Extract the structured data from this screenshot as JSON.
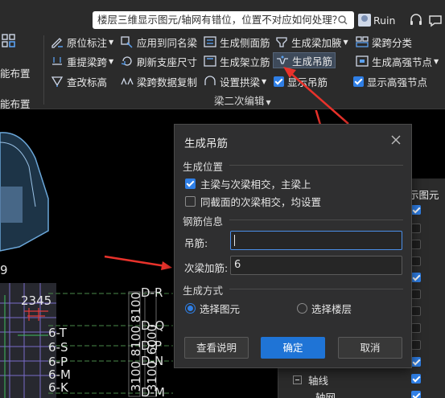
{
  "titlebar": {
    "search_text": "楼层三维显示图元/轴网有错位，位置不对应如何处理？",
    "username": "Ruin"
  },
  "ribbon": {
    "left_fragments": [
      "能布置",
      "能布置"
    ],
    "row1": [
      {
        "label": "原位标注",
        "icon": "annotation-icon",
        "caret": true
      },
      {
        "label": "应用到同名梁",
        "icon": "apply-same-name-icon"
      },
      {
        "label": "生成侧面筋",
        "icon": "side-rebar-icon"
      },
      {
        "label": "生成梁加腋",
        "icon": "haunch-icon",
        "caret": true
      },
      {
        "label": "梁跨分类",
        "icon": "span-classify-icon"
      }
    ],
    "row2": [
      {
        "label": "重提梁跨",
        "icon": "re-extract-span-icon",
        "caret": true
      },
      {
        "label": "刷新支座尺寸",
        "icon": "refresh-support-icon"
      },
      {
        "label": "生成架立筋",
        "icon": "erection-rebar-icon"
      },
      {
        "label": "生成吊筋",
        "icon": "hanger-rebar-icon"
      },
      {
        "label": "生成高强节点",
        "icon": "high-strength-node-icon",
        "caret": true
      }
    ],
    "row3": [
      {
        "label": "查改标高",
        "icon": "elevation-icon"
      },
      {
        "label": "梁跨数据复制",
        "icon": "span-copy-icon"
      },
      {
        "label": "设置拱梁",
        "icon": "arch-beam-icon",
        "caret": true
      },
      {
        "label": "显示吊筋",
        "checked": true
      },
      {
        "label": "显示高强节点",
        "checked": true
      }
    ],
    "group_label": "梁二次编辑"
  },
  "canvas": {
    "labels_h": [
      "9",
      "D-R",
      "D-Q",
      "D-P",
      "D-N",
      "D-M",
      "2345",
      "6-T",
      "6-S",
      "6-P",
      "6-M",
      "6-K"
    ],
    "labels_v": [
      "8100",
      "8100",
      "3100",
      "6000",
      "3100"
    ]
  },
  "side_panel": {
    "header": "示图元",
    "tree_axis": "轴线",
    "tree_grid": "轴网",
    "checks": [
      true,
      false,
      false,
      false,
      true,
      false,
      false,
      false,
      false,
      false,
      true,
      true,
      true
    ]
  },
  "dialog": {
    "title": "生成吊筋",
    "section_position": "生成位置",
    "option_main_secondary": "主梁与次梁相交，主梁上",
    "option_same_section": "同截面的次梁相交，均设置",
    "option_main_secondary_checked": true,
    "option_same_section_checked": false,
    "section_rebar": "钢筋信息",
    "hanger_label": "吊筋:",
    "hanger_value": "",
    "secondary_label": "次梁加筋:",
    "secondary_value": "6",
    "section_method": "生成方式",
    "radio_select_element": "选择图元",
    "radio_select_floor": "选择楼层",
    "selected_method": "选择图元",
    "btn_help": "查看说明",
    "btn_ok": "确定",
    "btn_cancel": "取消"
  },
  "colors": {
    "accent": "#2f7fe6",
    "primary_button": "#1f74d6",
    "arrow_red": "#e8322b",
    "dialog_bg": "#2f2f30",
    "ribbon_bg": "#2b2b2b"
  }
}
